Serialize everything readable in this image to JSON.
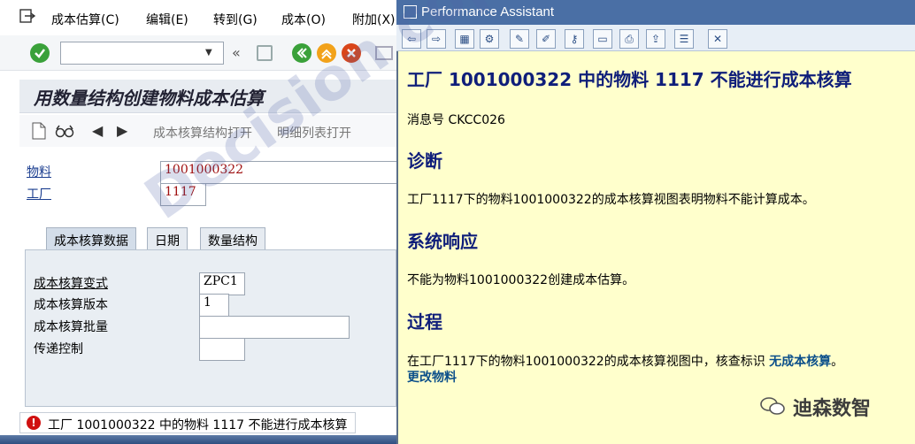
{
  "menu": {
    "items": [
      "成本估算(C)",
      "编辑(E)",
      "转到(G)",
      "成本(O)",
      "附加(X)"
    ]
  },
  "page": {
    "title": "用数量结构创建物料成本估算"
  },
  "app_toolbar": {
    "open_structure": "成本核算结构打开",
    "open_itemization": "明细列表打开"
  },
  "header_fields": {
    "material_label": "物料",
    "material_value": "1001000322",
    "plant_label": "工厂",
    "plant_value": "1117"
  },
  "tabs": [
    "成本核算数据",
    "日期",
    "数量结构"
  ],
  "costing_data": {
    "variant_label": "成本核算变式",
    "variant_value": "ZPC1",
    "version_label": "成本核算版本",
    "version_value": "1",
    "lot_size_label": "成本核算批量",
    "lot_size_value": "",
    "transfer_label": "传递控制",
    "transfer_value": ""
  },
  "status_bar": {
    "message": "工厂 1001000322 中的物料 1117 不能进行成本核算"
  },
  "performance_assistant": {
    "window_title": "Performance Assistant",
    "heading": "工厂  1001000322 中的物料  1117 不能进行成本核算",
    "message_number": "消息号  CKCC026",
    "diagnosis_title": "诊断",
    "diagnosis_text": "工厂1117下的物料1001000322的成本核算视图表明物料不能计算成本。",
    "system_response_title": "系统响应",
    "system_response_text": "不能为物料1001000322创建成本估算。",
    "procedure_title": "过程",
    "procedure_text": "在工厂1117下的物料1001000322的成本核算视图中，核查标识",
    "procedure_link": "无成本核算",
    "procedure_end": "。",
    "change_material_link": "更改物料"
  },
  "watermark": "Decision copyright",
  "wechat_badge": "迪森数智",
  "colors": {
    "pa_background": "#ffffcc",
    "pa_titlebar": "#4a6fa5",
    "heading_blue": "#0f1e7a",
    "error_red": "#d01010"
  }
}
